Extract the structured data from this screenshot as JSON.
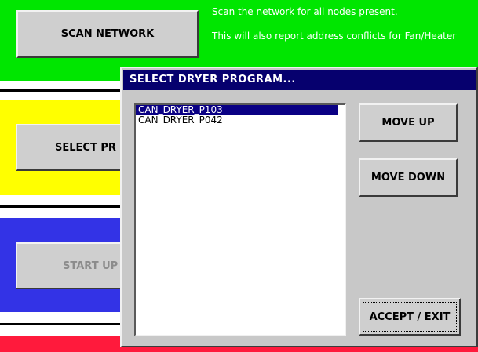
{
  "main": {
    "scan_button": "SCAN NETWORK",
    "scan_desc_line1": "Scan the network for all nodes present.",
    "scan_desc_line2": "This will also report address conflicts for Fan/Heater",
    "select_button": "SELECT PR",
    "start_button": "START UP"
  },
  "dialog": {
    "title": "SELECT DRYER PROGRAM...",
    "programs": [
      {
        "label": "CAN_DRYER_P103",
        "selected": true
      },
      {
        "label": "CAN_DRYER_P042",
        "selected": false
      }
    ],
    "move_up": "MOVE UP",
    "move_down": "MOVE DOWN",
    "accept": "ACCEPT / EXIT"
  },
  "colors": {
    "green": "#00e600",
    "yellow": "#ffff00",
    "blue": "#3333e6",
    "red": "#ff1a3c",
    "dialog_title": "#06006e",
    "selection": "#0a0084"
  }
}
